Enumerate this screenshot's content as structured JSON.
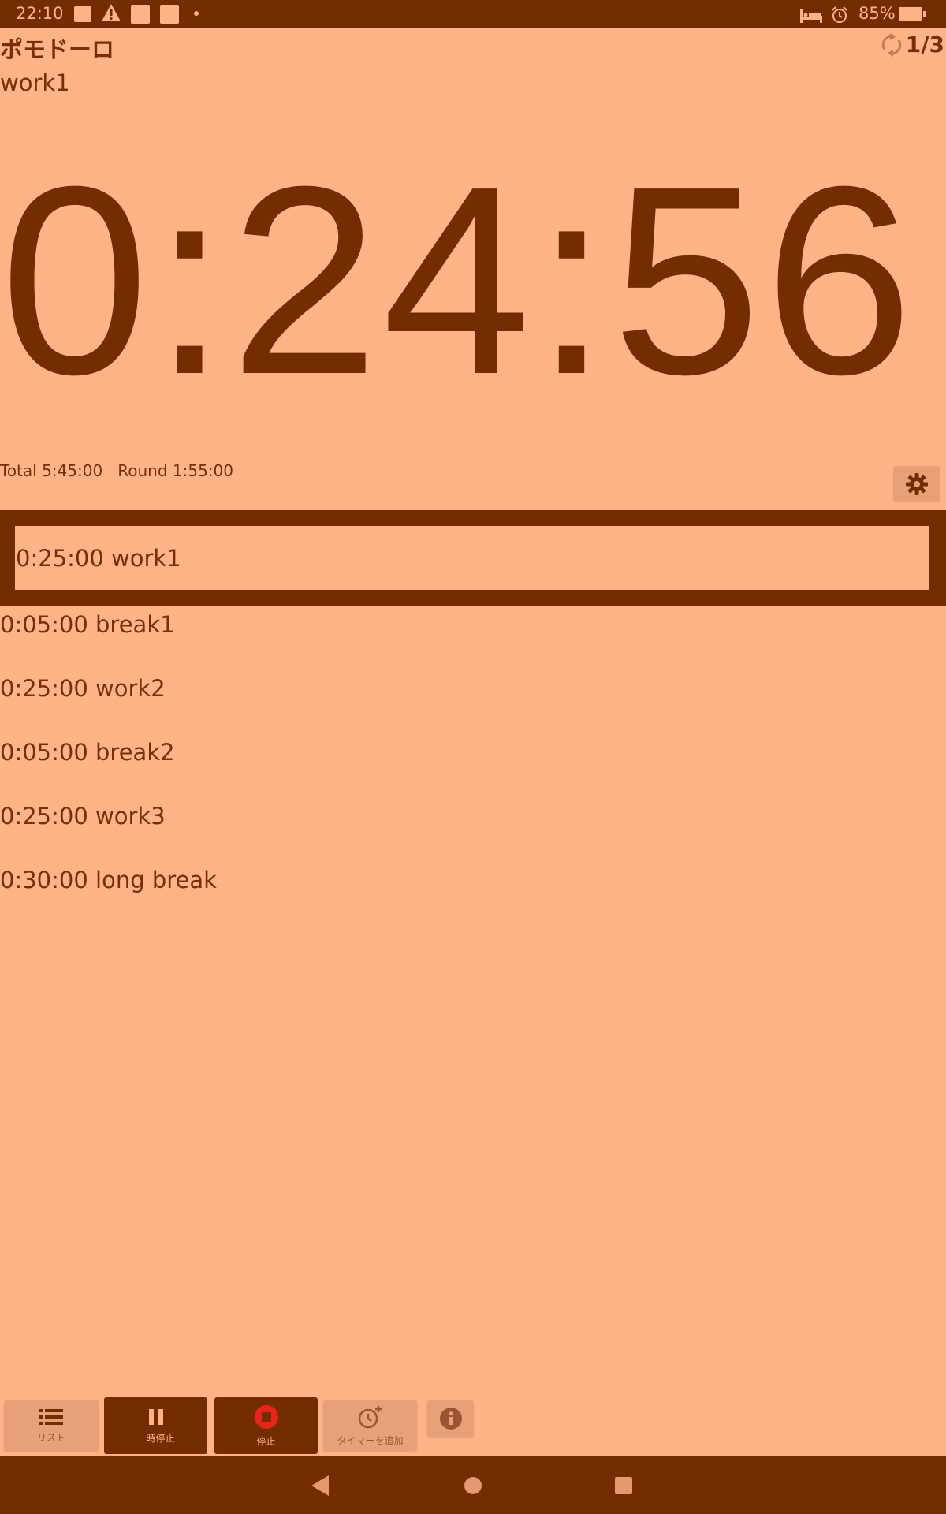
{
  "status_bar": {
    "time": "22:10",
    "battery": "85%",
    "icons": [
      "picture-icon",
      "warning-icon",
      "app-square-icon",
      "app-square-icon",
      "dot-icon",
      "bed-icon",
      "alarm-icon",
      "battery-charging-icon"
    ]
  },
  "header": {
    "title": "ポモドーロ",
    "round": "1/3"
  },
  "current": {
    "name": "work1",
    "time": "0:24:56",
    "totals": "Total 5:45:00   Round 1:55:00"
  },
  "selected_timer": {
    "label": "0:25:00 work1"
  },
  "timers": [
    {
      "label": "0:05:00 break1"
    },
    {
      "label": "0:25:00 work2"
    },
    {
      "label": "0:05:00 break2"
    },
    {
      "label": "0:25:00 work3"
    },
    {
      "label": "0:30:00 long break"
    }
  ],
  "toolbar": {
    "list": "リスト",
    "pause": "一時停止",
    "stop": "停止",
    "add_timer": "タイマーを追加"
  },
  "colors": {
    "background": "#FFB488",
    "dark": "#742D00",
    "stop_red": "#E8241A"
  }
}
